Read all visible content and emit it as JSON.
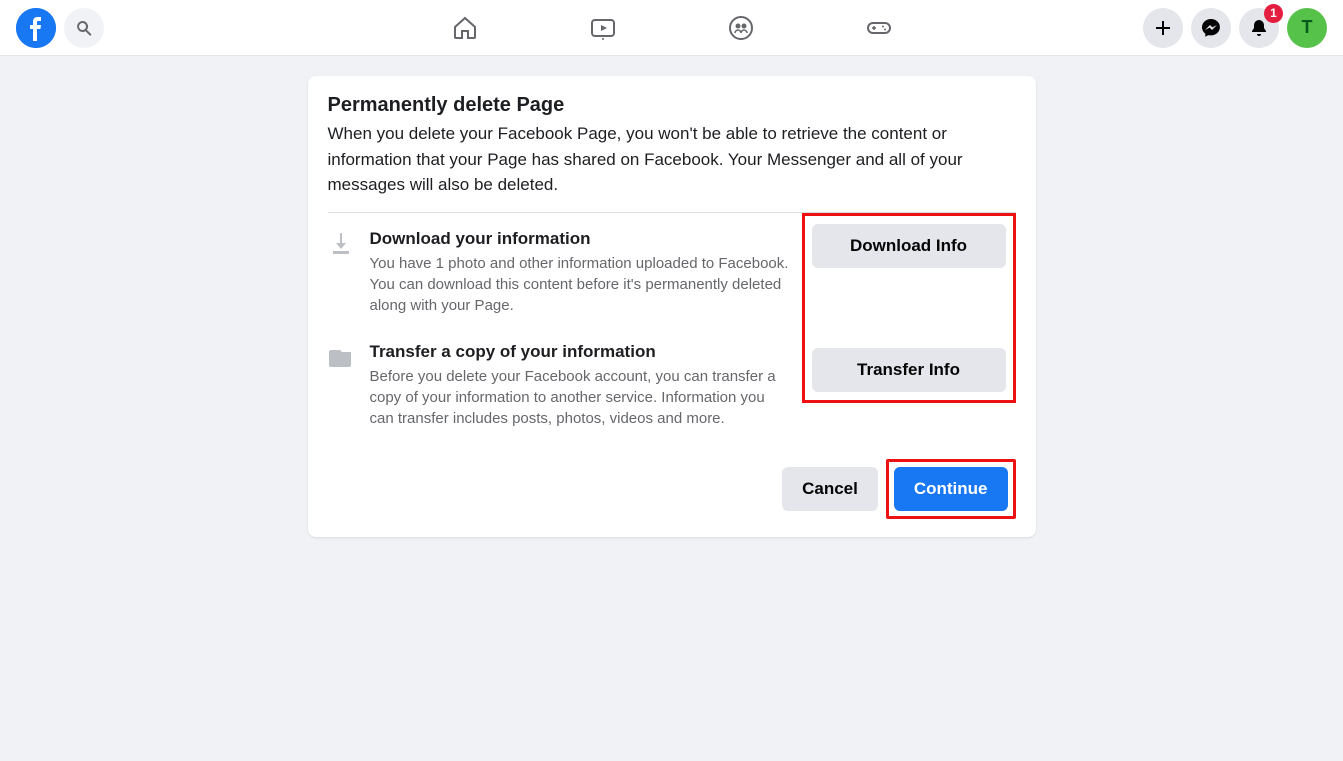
{
  "header": {
    "notification_count": "1",
    "avatar_initial": "T"
  },
  "dialog": {
    "title": "Permanently delete Page",
    "description": "When you delete your Facebook Page, you won't be able to retrieve the content or information that your Page has shared on Facebook. Your Messenger and all of your messages will also be deleted.",
    "option1": {
      "title": "Download your information",
      "desc": "You have 1 photo and other information uploaded to Facebook. You can download this content before it's permanently deleted along with your Page.",
      "button": "Download Info"
    },
    "option2": {
      "title": "Transfer a copy of your information",
      "desc": "Before you delete your Facebook account, you can transfer a copy of your information to another service. Information you can transfer includes posts, photos, videos and more.",
      "button": "Transfer Info"
    },
    "cancel": "Cancel",
    "continue": "Continue"
  }
}
